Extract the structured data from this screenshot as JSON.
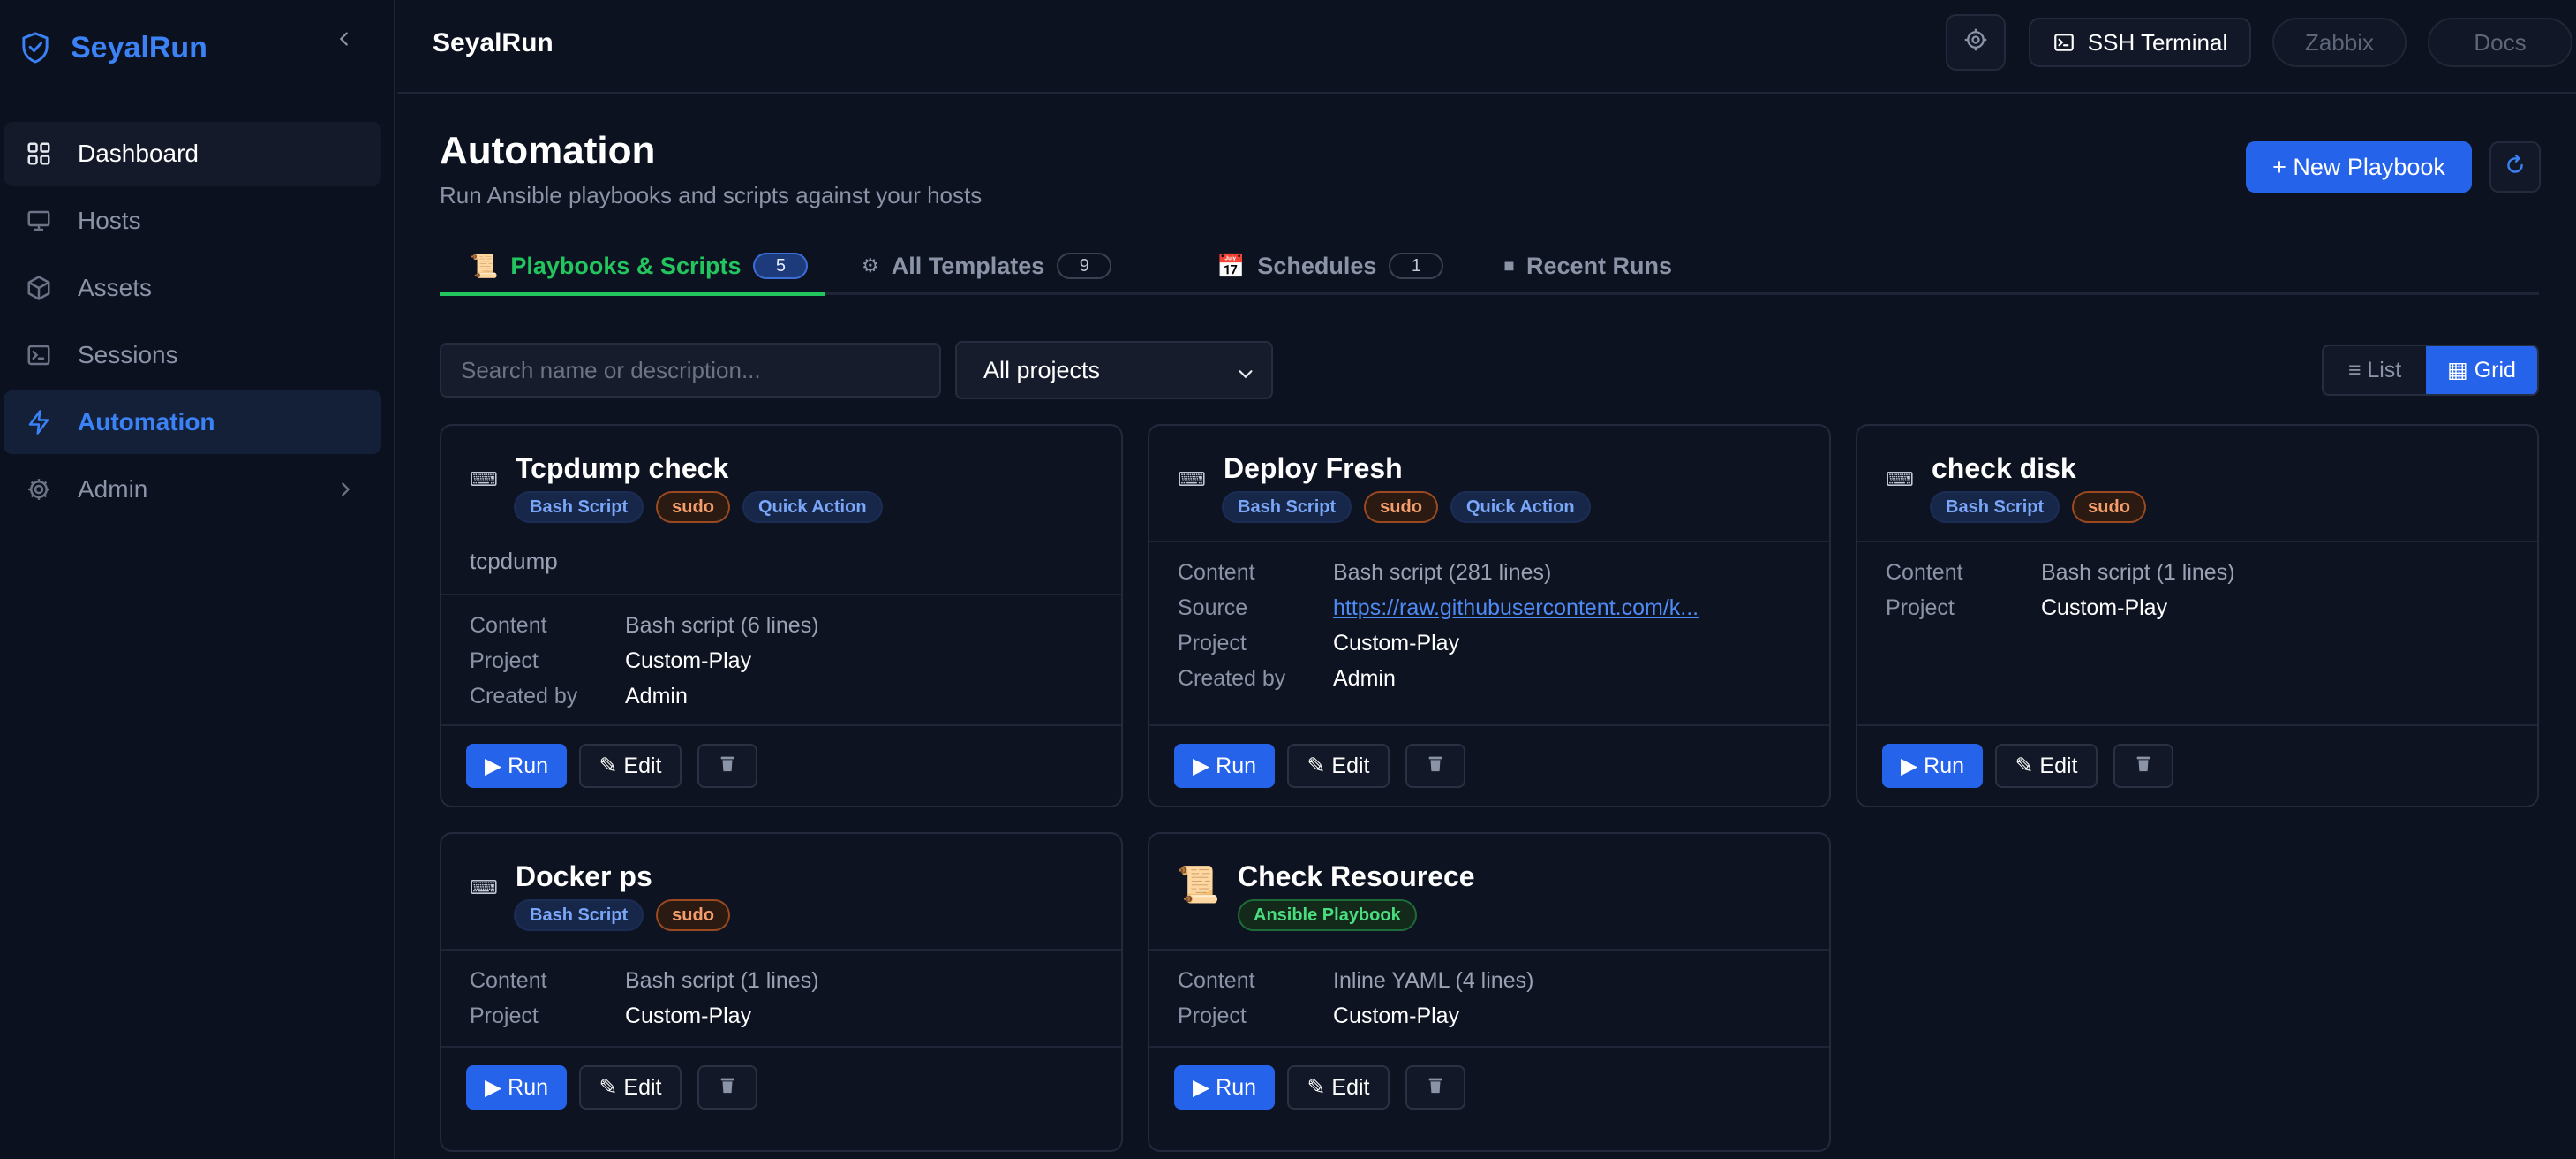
{
  "brand": {
    "name": "SeyalRun"
  },
  "sidebar": {
    "items": [
      {
        "label": "Dashboard",
        "icon": "grid-icon"
      },
      {
        "label": "Hosts",
        "icon": "monitor-icon"
      },
      {
        "label": "Assets",
        "icon": "box-icon"
      },
      {
        "label": "Sessions",
        "icon": "terminal-icon"
      },
      {
        "label": "Automation",
        "icon": "bolt-icon"
      },
      {
        "label": "Admin",
        "icon": "gear-icon"
      }
    ]
  },
  "topbar": {
    "title": "SeyalRun",
    "ssh_label": "SSH Terminal",
    "zabbix_label": "Zabbix",
    "docs_label": "Docs"
  },
  "page": {
    "title": "Automation",
    "subtitle": "Run Ansible playbooks and scripts against your hosts",
    "new_playbook_label": "+ New Playbook"
  },
  "tabs": [
    {
      "emoji": "📜",
      "label": "Playbooks & Scripts",
      "count": "5"
    },
    {
      "emoji": "⚙",
      "label": "All Templates",
      "count": "9"
    },
    {
      "emoji": "📅",
      "label": "Schedules",
      "count": "1"
    },
    {
      "emoji": "⏹",
      "label": "Recent Runs"
    }
  ],
  "filters": {
    "search_placeholder": "Search name or description...",
    "project_selected": "All projects",
    "view_list": "≡ List",
    "view_grid": "▦ Grid"
  },
  "labels": {
    "content": "Content",
    "project": "Project",
    "created_by": "Created by",
    "source": "Source",
    "run": "▶ Run",
    "edit": "✎ Edit"
  },
  "cards": [
    {
      "title": "Tcpdump check",
      "badges": [
        "Bash Script",
        "sudo",
        "Quick Action"
      ],
      "description": "tcpdump",
      "content": "Bash script (6 lines)",
      "project": "Custom-Play",
      "created_by": "Admin"
    },
    {
      "title": "Deploy Fresh",
      "badges": [
        "Bash Script",
        "sudo",
        "Quick Action"
      ],
      "content": "Bash script (281 lines)",
      "source": "https://raw.githubusercontent.com/k...",
      "project": "Custom-Play",
      "created_by": "Admin"
    },
    {
      "title": "check disk",
      "badges": [
        "Bash Script",
        "sudo"
      ],
      "content": "Bash script (1 lines)",
      "project": "Custom-Play"
    },
    {
      "title": "Docker ps",
      "badges": [
        "Bash Script",
        "sudo"
      ],
      "content": "Bash script (1 lines)",
      "project": "Custom-Play"
    },
    {
      "title": "Check Resourece",
      "badges": [
        "Ansible Playbook"
      ],
      "content": "Inline YAML (4 lines)",
      "project": "Custom-Play"
    }
  ],
  "colors": {
    "accent": "#2563eb",
    "brand": "#3b82f6",
    "active_tab": "#22c55e"
  }
}
